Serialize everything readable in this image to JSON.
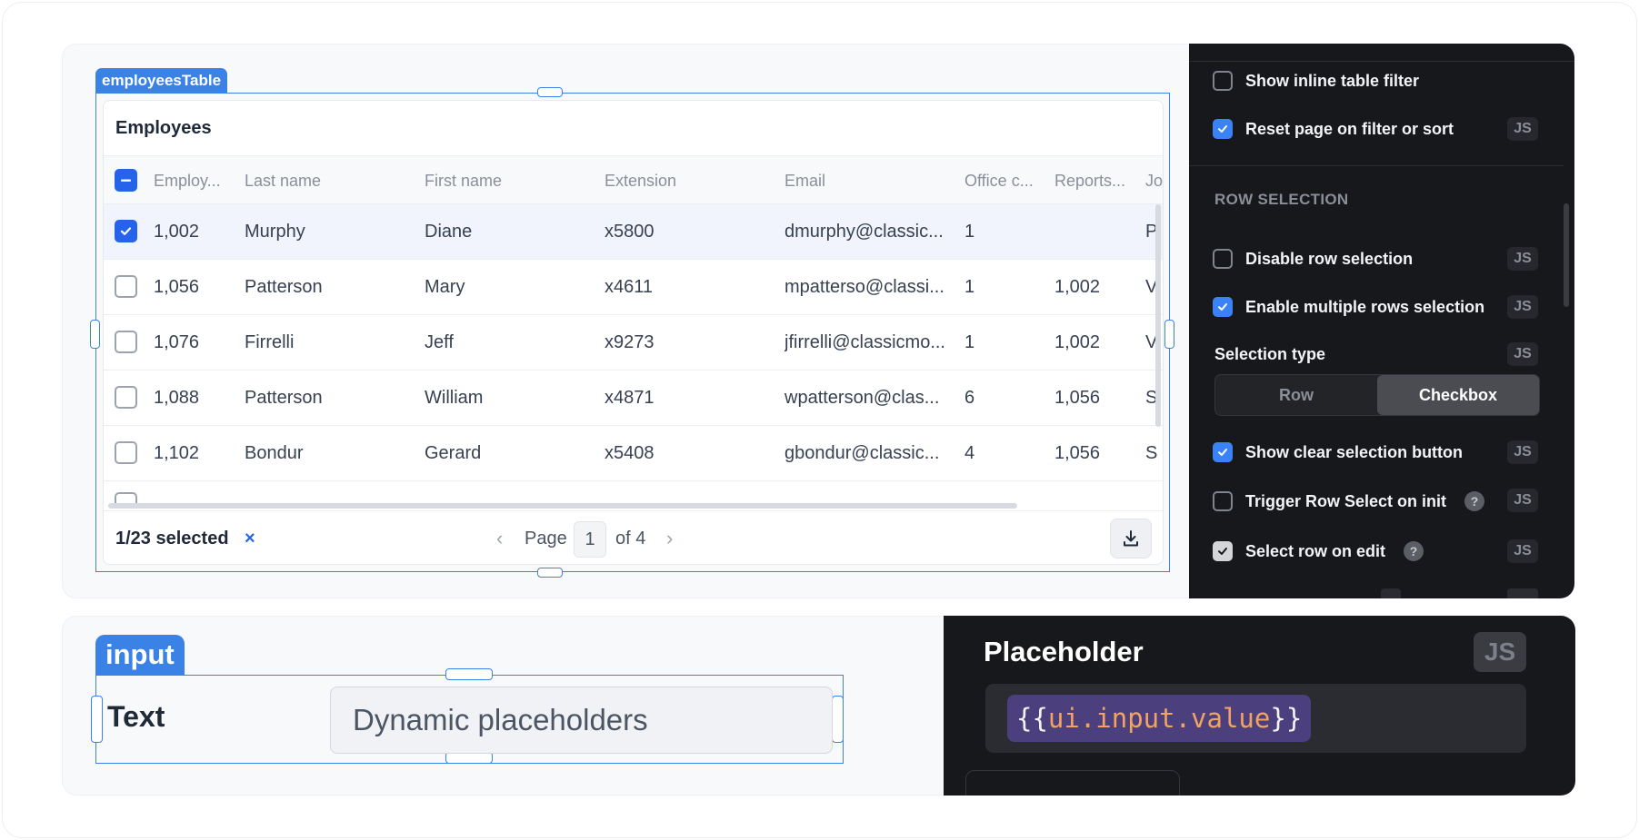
{
  "table_tag": "employeesTable",
  "table": {
    "title": "Employees",
    "columns": [
      "Employ...",
      "Last name",
      "First name",
      "Extension",
      "Email",
      "Office c...",
      "Reports...",
      "Jo"
    ],
    "rows": [
      {
        "selected": true,
        "cells": [
          "1,002",
          "Murphy",
          "Diane",
          "x5800",
          "dmurphy@classic...",
          "1",
          "",
          "P"
        ]
      },
      {
        "selected": false,
        "cells": [
          "1,056",
          "Patterson",
          "Mary",
          "x4611",
          "mpatterso@classi...",
          "1",
          "1,002",
          "V"
        ]
      },
      {
        "selected": false,
        "cells": [
          "1,076",
          "Firrelli",
          "Jeff",
          "x9273",
          "jfirrelli@classicmo...",
          "1",
          "1,002",
          "V"
        ]
      },
      {
        "selected": false,
        "cells": [
          "1,088",
          "Patterson",
          "William",
          "x4871",
          "wpatterson@clas...",
          "6",
          "1,056",
          "S"
        ]
      },
      {
        "selected": false,
        "cells": [
          "1,102",
          "Bondur",
          "Gerard",
          "x5408",
          "gbondur@classic...",
          "4",
          "1,056",
          "S"
        ]
      }
    ],
    "footer": {
      "selected_text": "1/23 selected",
      "clear_glyph": "×",
      "page_label": "Page",
      "page_current": "1",
      "page_total": "of 4",
      "prev_glyph": "‹",
      "next_glyph": "›"
    }
  },
  "inspector": {
    "items_top": [
      {
        "label": "Show inline table filter",
        "checked": false,
        "js": false
      },
      {
        "label": "Reset page on filter or sort",
        "checked": true,
        "js": true
      }
    ],
    "section_title": "ROW SELECTION",
    "items": [
      {
        "label": "Disable row selection",
        "checked": false,
        "js": true
      },
      {
        "label": "Enable multiple rows selection",
        "checked": true,
        "js": true
      }
    ],
    "selection_type": {
      "label": "Selection type",
      "options": [
        "Row",
        "Checkbox"
      ],
      "active": "Checkbox"
    },
    "items_bottom": [
      {
        "label": "Show clear selection button",
        "checked": true,
        "js": true
      },
      {
        "label": "Trigger Row Select on init",
        "checked": false,
        "js": true,
        "help": true
      },
      {
        "label": "Select row on edit",
        "checked": true,
        "js": true,
        "help": true
      }
    ],
    "js_label": "JS",
    "help_glyph": "?"
  },
  "input_tag": "input",
  "input": {
    "label": "Text",
    "placeholder": "Dynamic placeholders"
  },
  "placeholder_panel": {
    "title": "Placeholder",
    "js_label": "JS",
    "code_open": "{{",
    "code_expr": "ui.input.value",
    "code_close": "}}"
  },
  "colors": {
    "accent": "#3b82e6",
    "checkbox_on": "#2563eb",
    "dark_panel": "#17181c",
    "code_bg": "#4b3f7d",
    "code_keyword": "#f4a261"
  }
}
